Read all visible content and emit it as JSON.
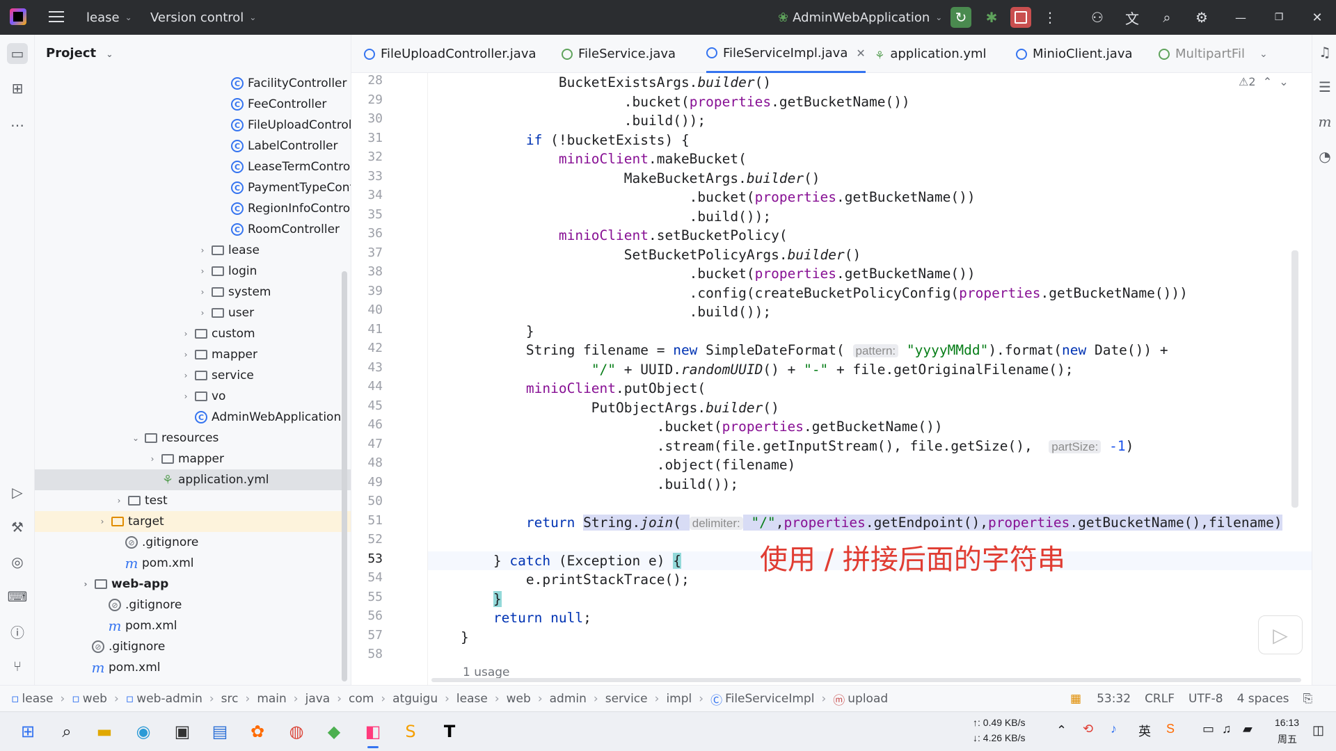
{
  "titlebar": {
    "project": "lease",
    "vcs": "Version control",
    "run_config": "AdminWebApplication"
  },
  "project_panel": {
    "title": "Project",
    "items": [
      {
        "label": "FacilityController",
        "type": "class",
        "depth": 0
      },
      {
        "label": "FeeController",
        "type": "class"
      },
      {
        "label": "FileUploadControll",
        "type": "class"
      },
      {
        "label": "LabelController",
        "type": "class"
      },
      {
        "label": "LeaseTermControl",
        "type": "class"
      },
      {
        "label": "PaymentTypeCont",
        "type": "class"
      },
      {
        "label": "RegionInfoControll",
        "type": "class"
      },
      {
        "label": "RoomController",
        "type": "class"
      },
      {
        "label": "lease",
        "type": "package"
      },
      {
        "label": "login",
        "type": "package"
      },
      {
        "label": "system",
        "type": "package"
      },
      {
        "label": "user",
        "type": "package"
      },
      {
        "label": "custom",
        "type": "package"
      },
      {
        "label": "mapper",
        "type": "package"
      },
      {
        "label": "service",
        "type": "package"
      },
      {
        "label": "vo",
        "type": "package"
      },
      {
        "label": "AdminWebApplication",
        "type": "class"
      },
      {
        "label": "resources",
        "type": "folder"
      },
      {
        "label": "mapper",
        "type": "folder"
      },
      {
        "label": "application.yml",
        "type": "yml"
      },
      {
        "label": "test",
        "type": "folder"
      },
      {
        "label": "target",
        "type": "folder"
      },
      {
        "label": ".gitignore",
        "type": "ignore"
      },
      {
        "label": "pom.xml",
        "type": "maven"
      },
      {
        "label": "web-app",
        "type": "module"
      },
      {
        "label": ".gitignore",
        "type": "ignore"
      },
      {
        "label": "pom.xml",
        "type": "maven"
      },
      {
        "label": ".gitignore",
        "type": "ignore"
      },
      {
        "label": "pom.xml",
        "type": "maven"
      }
    ]
  },
  "tabs": [
    {
      "label": "FileUploadController.java"
    },
    {
      "label": "FileService.java"
    },
    {
      "label": "FileServiceImpl.java",
      "active": true
    },
    {
      "label": "application.yml"
    },
    {
      "label": "MinioClient.java"
    },
    {
      "label": "MultipartFil"
    }
  ],
  "editor": {
    "warnings": "⚠2",
    "line_numbers": [
      "28",
      "29",
      "30",
      "31",
      "32",
      "33",
      "34",
      "35",
      "36",
      "37",
      "38",
      "39",
      "40",
      "41",
      "42",
      "43",
      "44",
      "45",
      "46",
      "47",
      "48",
      "49",
      "50",
      "51",
      "52",
      "53",
      "54",
      "55",
      "56",
      "57",
      "58"
    ],
    "usages": "1 usage",
    "overlay_caption": "使用 / 拼接后面的字符串",
    "hints": {
      "pattern": "pattern:",
      "partsize": "partSize:",
      "delimiter": "delimiter:"
    }
  },
  "statusbar": {
    "breadcrumbs": [
      "lease",
      "web",
      "web-admin",
      "src",
      "main",
      "java",
      "com",
      "atguigu",
      "lease",
      "web",
      "admin",
      "service",
      "impl",
      "FileServiceImpl",
      "upload"
    ],
    "position": "53:32",
    "line_sep": "CRLF",
    "encoding": "UTF-8",
    "indent": "4 spaces"
  },
  "taskbar": {
    "net_up": "↑: 0.49 KB/s",
    "net_down": "↓: 4.26 KB/s",
    "time": "16:13",
    "day": "周五"
  },
  "colors": {
    "keyword": "#0033b3",
    "field": "#871094",
    "string": "#067d17",
    "overlay": "#e03c32"
  }
}
